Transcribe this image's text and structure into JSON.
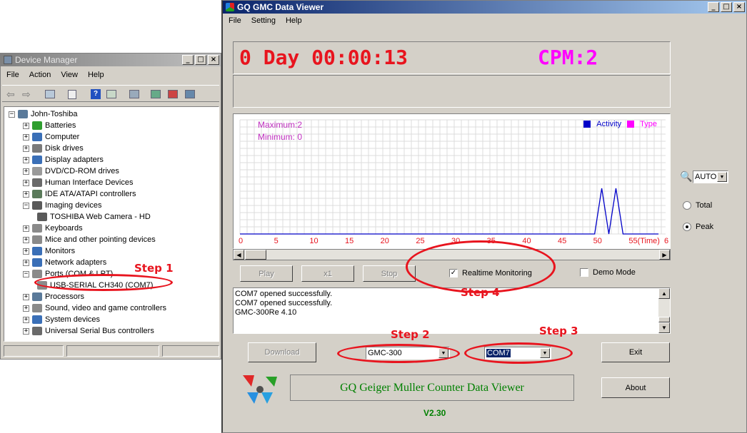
{
  "device_manager": {
    "title": "Device Manager",
    "menu": [
      "File",
      "Action",
      "View",
      "Help"
    ],
    "root": "John-Toshiba",
    "categories": [
      {
        "label": "Batteries",
        "color": "#2f9e2f"
      },
      {
        "label": "Computer",
        "color": "#3a6fb7"
      },
      {
        "label": "Disk drives",
        "color": "#7a7a7a"
      },
      {
        "label": "Display adapters",
        "color": "#3a6fb7"
      },
      {
        "label": "DVD/CD-ROM drives",
        "color": "#9a9a9a"
      },
      {
        "label": "Human Interface Devices",
        "color": "#6a6a6a"
      },
      {
        "label": "IDE ATA/ATAPI controllers",
        "color": "#5a7a5a"
      },
      {
        "label": "Imaging devices",
        "color": "#5a5a5a"
      },
      {
        "label": "TOSHIBA Web Camera - HD",
        "color": "#5a5a5a"
      },
      {
        "label": "Keyboards",
        "color": "#8a8a8a"
      },
      {
        "label": "Mice and other pointing devices",
        "color": "#8a8a8a"
      },
      {
        "label": "Monitors",
        "color": "#3a6fb7"
      },
      {
        "label": "Network adapters",
        "color": "#3a6fb7"
      },
      {
        "label": "Ports (COM & LPT)",
        "color": "#8a8a8a"
      },
      {
        "label": "USB-SERIAL CH340 (COM7)",
        "color": "#8a8a8a"
      },
      {
        "label": "Processors",
        "color": "#5a7a9a"
      },
      {
        "label": "Sound, video and game controllers",
        "color": "#8a8a8a"
      },
      {
        "label": "System devices",
        "color": "#3a6fb7"
      },
      {
        "label": "Universal Serial Bus controllers",
        "color": "#6a6a6a"
      }
    ]
  },
  "steps": {
    "step1": "Step 1",
    "step2": "Step 2",
    "step3": "Step 3",
    "step4": "Step 4"
  },
  "gq": {
    "title": "GQ GMC Data Viewer",
    "menu": [
      "File",
      "Setting",
      "Help"
    ],
    "timer": "0 Day 00:00:13",
    "cpm": "CPM:2",
    "max_label": "Maximum:2",
    "min_label": "Minimum: 0",
    "legend_activity": "Activity",
    "legend_type": "Type",
    "zoom_value": "AUTO",
    "radio_total": "Total",
    "radio_peak": "Peak",
    "btn_play": "Play",
    "btn_x1": "x1",
    "btn_stop": "Stop",
    "realtime_label": "Realtime Monitoring",
    "demo_label": "Demo Mode",
    "log_lines": [
      "COM7 opened successfully.",
      "COM7 opened successfully.",
      "GMC-300Re 4.10"
    ],
    "btn_download": "Download",
    "model_value": "GMC-300",
    "port_value": "COM7",
    "btn_exit": "Exit",
    "btn_about": "About",
    "banner": "GQ Geiger Muller Counter Data Viewer",
    "version": "V2.30",
    "colors": {
      "timer": "#e8141e",
      "cpm": "#ff00ff",
      "activity": "#0000c8",
      "type": "#ff00ff",
      "green": "#008000"
    }
  },
  "chart_data": {
    "type": "line",
    "x_ticks": [
      "0",
      "5",
      "10",
      "15",
      "20",
      "25",
      "30",
      "35",
      "40",
      "45",
      "50",
      "55(Time)",
      "6"
    ],
    "series": [
      {
        "name": "Activity",
        "x": [
          0,
          1,
          2,
          3,
          4,
          5,
          6,
          7,
          8,
          9,
          10,
          11,
          12,
          13,
          14,
          15,
          16,
          17,
          18,
          19,
          20,
          21,
          22,
          23,
          24,
          25,
          26,
          27,
          28,
          29,
          30,
          31,
          32,
          33,
          34,
          35,
          36,
          37,
          38,
          39,
          40,
          41,
          42,
          43,
          44,
          45,
          46,
          47,
          48,
          49,
          50,
          51,
          52,
          53,
          54,
          55,
          56,
          57,
          58,
          59
        ],
        "y": [
          0,
          0,
          0,
          0,
          0,
          0,
          0,
          0,
          0,
          0,
          0,
          0,
          0,
          0,
          0,
          0,
          0,
          0,
          0,
          0,
          0,
          0,
          0,
          0,
          0,
          0,
          0,
          0,
          0,
          0,
          0,
          0,
          0,
          0,
          0,
          0,
          0,
          0,
          0,
          0,
          0,
          0,
          0,
          0,
          0,
          0,
          0,
          0,
          0,
          0,
          0,
          2,
          0,
          2,
          0,
          0,
          0,
          0,
          0,
          0
        ]
      }
    ],
    "ylim": [
      0,
      5
    ],
    "xlim": [
      0,
      60
    ],
    "grid": true,
    "legend": "top-right"
  }
}
